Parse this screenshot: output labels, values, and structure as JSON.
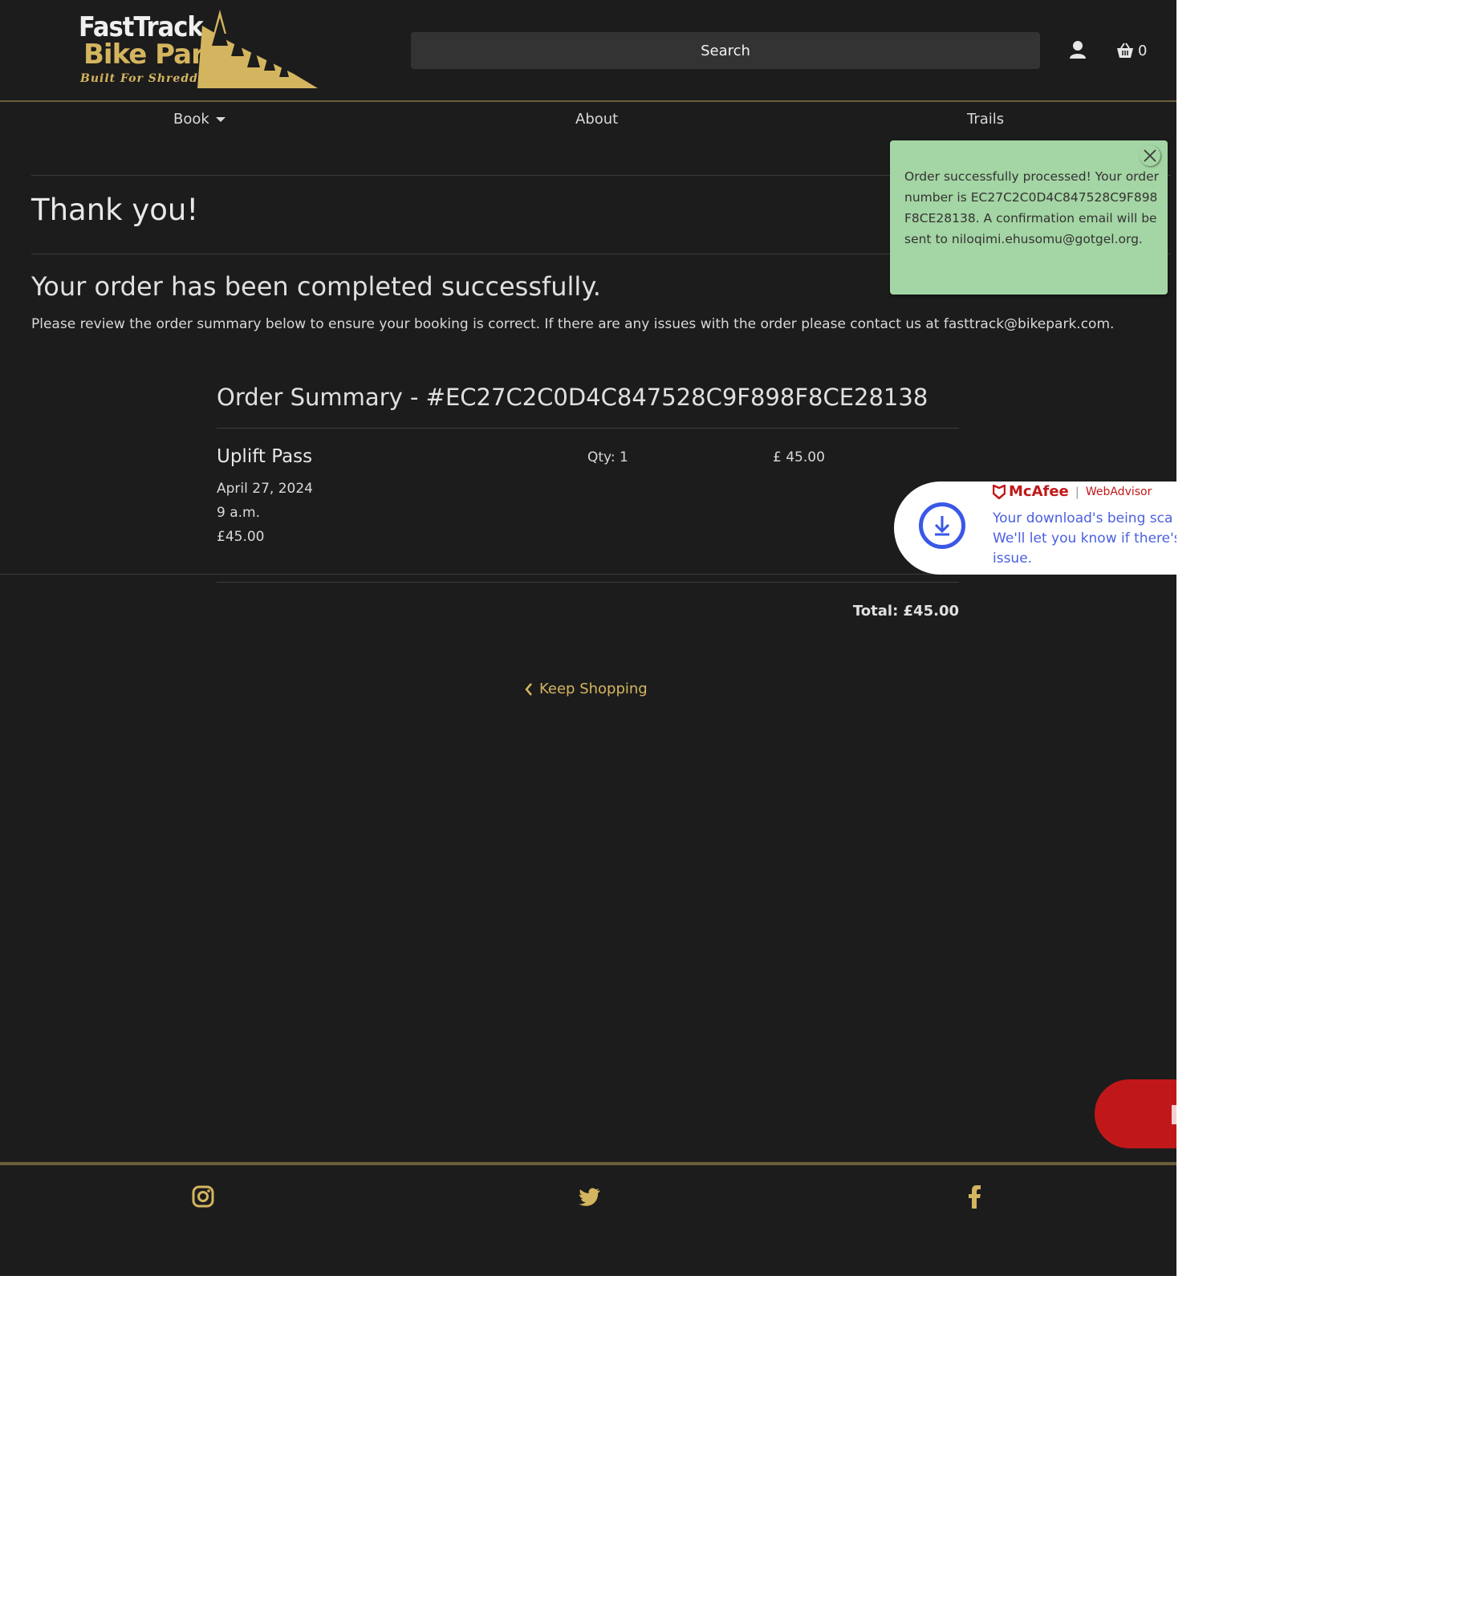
{
  "header": {
    "logo": {
      "line1": "FastTrack",
      "line2": "Bike Park",
      "tagline": "Built For Shredding"
    },
    "search_placeholder": "Search",
    "cart_count": "0"
  },
  "nav": {
    "items": [
      {
        "label": "Book"
      },
      {
        "label": "About"
      },
      {
        "label": "Trails"
      }
    ]
  },
  "main": {
    "title": "Thank you!",
    "subtitle": "Your order has been completed successfully.",
    "intro": "Please review the order summary below to ensure your booking is correct. If there are any issues with the order please contact us at fasttrack@bikepark.com.",
    "summary_title": "Order Summary - #EC27C2C0D4C847528C9F898F8CE28138",
    "item": {
      "name": "Uplift Pass",
      "date": "April 27, 2024",
      "time": "9 a.m.",
      "price_line": "£45.00",
      "qty": "Qty: 1",
      "price": "£ 45.00"
    },
    "total": "Total: £45.00",
    "keep_shopping": "Keep Shopping"
  },
  "toast": {
    "message": "Order successfully processed! Your order number is EC27C2C0D4C847528C9F898F8CE28138. A confirmation email will be sent to niloqimi.ehusomu@gotgel.org."
  },
  "mcafee": {
    "brand": "McAfee",
    "product": "WebAdvisor",
    "message": "Your download's being sca\nWe'll let you know if there's\nissue."
  },
  "colors": {
    "background": "#1c1c1c",
    "accent_gold": "#d4b55f",
    "toast_green": "#a4d5a4",
    "mcafee_red": "#c01818",
    "mcafee_blue": "#3a57e8"
  },
  "icons": {
    "user": "user-icon",
    "cart": "basket-icon",
    "instagram": "instagram-icon",
    "twitter": "twitter-icon",
    "facebook": "facebook-icon",
    "download": "download-icon"
  }
}
